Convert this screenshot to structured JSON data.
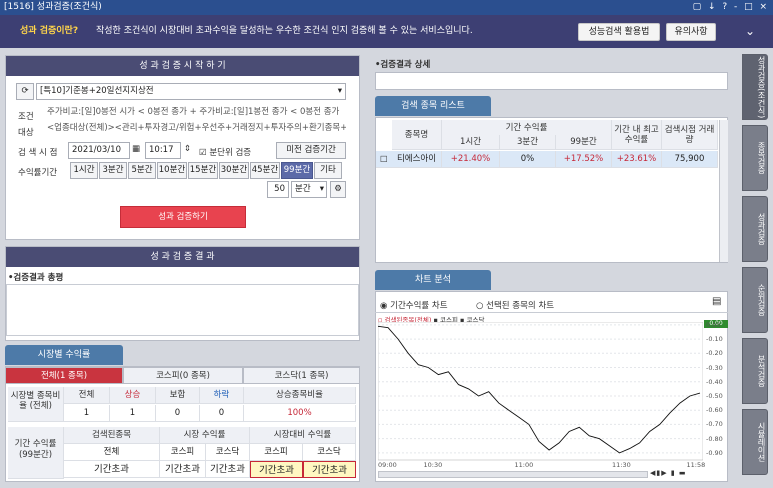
{
  "window": {
    "title": "[1516] 성과검증(조건식)",
    "controls": "▢ ↓ ? - □ ×"
  },
  "banner": {
    "question": "성과 검증이란?",
    "description": "작성한 조건식이 시장대비 초과수익을 달성하는 우수한 조건식 인지 검증해 볼 수 있는 서비스입니다.",
    "btn_guide": "성능검색 활용법",
    "btn_notes": "유의사항"
  },
  "start": {
    "header": "성 과 검 증 시 작 하 기",
    "condition_select": "[특10]기준봉+20일선지지상전",
    "label_condition": "조건",
    "label_target": "대상",
    "condition_text": "주가비교:[일]0봉전 시가 < 0봉전 종가 + 주가비교:[일]1봉전 종가 < 0봉전 종가",
    "target_text": "<업종대상(전체)><관리+투자경고/위험+우선주+거래정지+투자주의+환기종목+정",
    "label_time": "검 색 시 점",
    "date": "2021/03/10",
    "time": "10:17",
    "chk_minute": "분단위 검증",
    "btn_past": "미전 검증기간",
    "label_period": "수익률기간",
    "periods": [
      "1시간",
      "3분간",
      "5분간",
      "10분간",
      "15분간",
      "30분간",
      "45분간",
      "99분간",
      "기타"
    ],
    "selected_period": "99분간",
    "custom_value": "50",
    "custom_unit": "분간",
    "run_button": "성과 검증하기"
  },
  "result": {
    "header": "성 과 검 증 결 과",
    "summary_label": "•검증결과 총평"
  },
  "market": {
    "tab_title": "시장별 수익률",
    "tabs": [
      "전체(1 종목)",
      "코스피(0 종목)",
      "코스닥(1 종목)"
    ],
    "row1_label": "시장별 종목비율 (전체)",
    "row1_headers": [
      "전체",
      "상승",
      "보합",
      "하락",
      "상승종목비율"
    ],
    "row1_values": [
      "1",
      "1",
      "0",
      "0",
      "100%"
    ],
    "row2_label": "기간 수익률 (99분간)",
    "row2_groups": [
      "검색된종목",
      "시장 수익률",
      "시장대비 수익률"
    ],
    "row2_headers": [
      "전체",
      "코스피",
      "코스닥",
      "코스피",
      "코스닥"
    ],
    "row2_values": [
      "기간초과",
      "기간초과",
      "기간초과",
      "기간초과",
      "기간초과"
    ]
  },
  "detail": {
    "label": "•검증결과 상세"
  },
  "list": {
    "tab_title": "검색 종목 리스트",
    "headers": {
      "name": "종목명",
      "period_group": "기간 수익률",
      "h1": "1시간",
      "h3": "3분간",
      "h99": "99분간",
      "max": "기간 내 최고수익률",
      "volume": "검색시점 거래량"
    },
    "rows": [
      {
        "name": "티에스아이",
        "r1": "+21.40%",
        "r3": "0%",
        "r99": "+17.52%",
        "max": "+23.61%",
        "volume": "75,900"
      }
    ]
  },
  "chart": {
    "tab_title": "차트 분석",
    "radio1": "기간수익률 차트",
    "radio2": "선택된 종목의 차트",
    "legend": "검색된종목(전체)",
    "legend2": "코스피",
    "legend3": "코스닥",
    "current_label": "0.00"
  },
  "chart_data": {
    "type": "line",
    "x": [
      "09:00",
      "10:30",
      "11:00",
      "11:30",
      "11:58"
    ],
    "y_ticks": [
      "0.00",
      "-0.10",
      "-0.20",
      "-0.30",
      "-0.40",
      "-0.50",
      "-0.60",
      "-0.70",
      "-0.80",
      "-0.90"
    ],
    "ylim": [
      -0.95,
      0.02
    ],
    "series": [
      {
        "name": "검색된종목(전체)",
        "values": [
          -0.01,
          -0.02,
          -0.1,
          -0.2,
          -0.28,
          -0.3,
          -0.35,
          -0.33,
          -0.42,
          -0.45,
          -0.5,
          -0.47,
          -0.55,
          -0.6,
          -0.65,
          -0.7,
          -0.82,
          -0.88,
          -0.83,
          -0.75,
          -0.72,
          -0.78,
          -0.8,
          -0.85,
          -0.9,
          -0.87,
          -0.83,
          -0.75,
          -0.7,
          -0.62,
          -0.55,
          -0.5,
          -0.48
        ]
      }
    ]
  },
  "sidebar": [
    "성과검증(조건식)",
    "종목검증",
    "성과검증",
    "순위검증",
    "분석검증",
    "시뮬레이션"
  ]
}
